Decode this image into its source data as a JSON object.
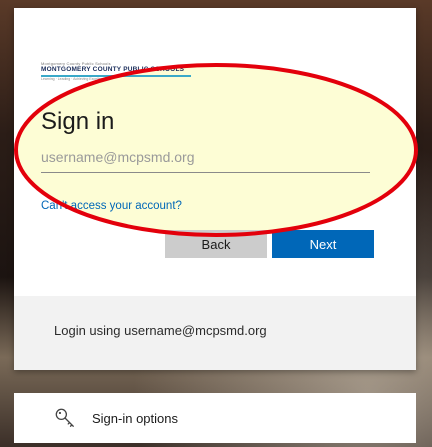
{
  "logo": {
    "tagline_top": "Montgomery County Public Schools",
    "name": "MONTGOMERY COUNTY PUBLIC SCHOOLS",
    "tagline_bottom": "Learning · Leading · Achieving Excellence"
  },
  "signin": {
    "title": "Sign in",
    "username_placeholder": "username@mcpsmd.org",
    "cant_access": "Can't access your account?",
    "back_label": "Back",
    "next_label": "Next"
  },
  "footer": {
    "login_hint": "Login using username@mcpsmd.org"
  },
  "options": {
    "label": "Sign-in options",
    "icon": "key-icon"
  },
  "colors": {
    "accent": "#0067b8",
    "highlight_fill": "#fdfdd0",
    "highlight_stroke": "#e3000b"
  }
}
